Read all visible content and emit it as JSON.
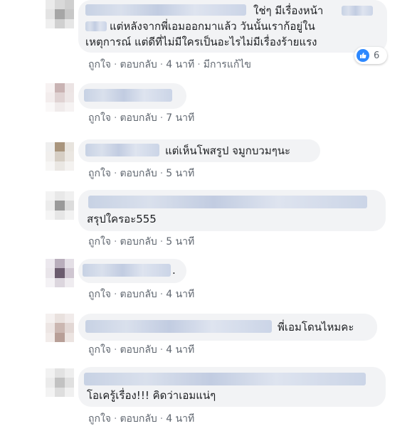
{
  "ui": {
    "like_label": "ถูกใจ",
    "reply_label": "ตอบกลับ",
    "separator": "·"
  },
  "comments": [
    {
      "lines": [
        "ใช่ๆ มีเรื่องหน้า",
        "แต่หลังจากพี่เอมออกมาแล้ว วันนั้นเราก้อยู่ใน",
        "เหตุการณ์ แต่ดีที่ไม่มีใครเป็นอะไรไม่มีเรื่องร้ายแรง"
      ],
      "time": "4 นาที",
      "edited": "มีการแก้ไข",
      "reaction_count": "6",
      "reaction_icon": "like-icon"
    },
    {
      "lines": [],
      "time": "7 นาที"
    },
    {
      "lines": [
        "แต่เห็นโพสรูป จมูกบวมๆนะ"
      ],
      "time": "5 นาที"
    },
    {
      "lines": [
        "สรุปใครอะ555"
      ],
      "time": "5 นาที"
    },
    {
      "lines": [
        "."
      ],
      "time": "4 นาที"
    },
    {
      "lines": [
        "พี่เอมโดนไหมคะ"
      ],
      "time": "4 นาที"
    },
    {
      "lines": [
        "โอเครู้เรื่อง!!! คิดว่าเอมแน่ๆ"
      ],
      "time": "4 นาที"
    }
  ]
}
